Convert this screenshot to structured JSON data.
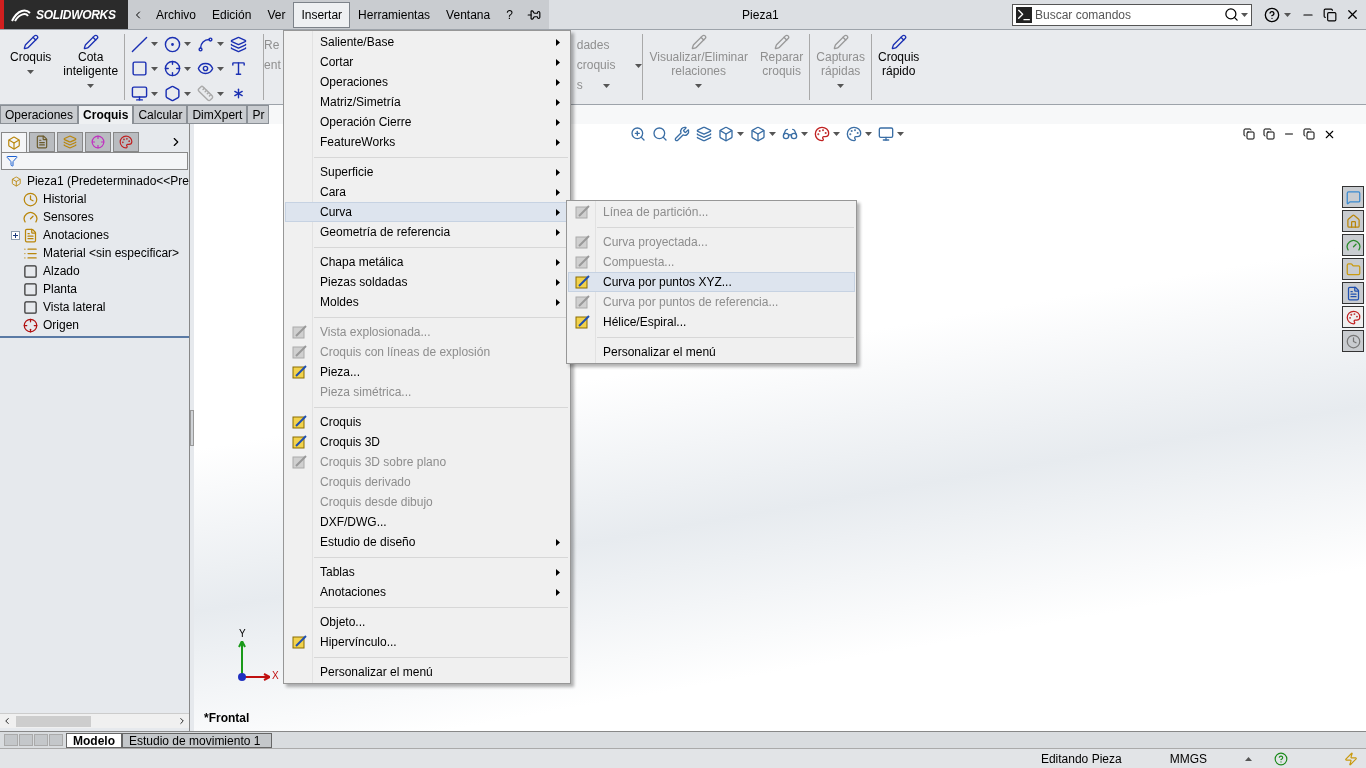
{
  "app": {
    "logo_text": "SOLIDWORKS",
    "title": "Pieza1"
  },
  "menu_bar": [
    {
      "label": "Archivo",
      "selected": false
    },
    {
      "label": "Edición",
      "selected": false
    },
    {
      "label": "Ver",
      "selected": false
    },
    {
      "label": "Insertar",
      "selected": true
    },
    {
      "label": "Herramientas",
      "selected": false
    },
    {
      "label": "Ventana",
      "selected": false
    },
    {
      "label": "?",
      "selected": false
    }
  ],
  "search": {
    "placeholder": "Buscar comandos"
  },
  "ribbon_left": [
    {
      "kind": "big",
      "lines": [
        "Croquis"
      ],
      "disabled": false,
      "dropdown": true
    },
    {
      "kind": "big",
      "lines": [
        "Cota",
        "inteligente"
      ],
      "disabled": false,
      "dropdown": true
    },
    {
      "kind": "separator"
    },
    {
      "kind": "tools"
    },
    {
      "kind": "separator"
    },
    {
      "kind": "cut",
      "lines": [
        "Re",
        "ent"
      ],
      "disabled": true
    }
  ],
  "ribbon_right": [
    {
      "kind": "cut",
      "lines": [
        "dades",
        "croquis",
        "s"
      ],
      "disabled": true,
      "dropdown": true
    },
    {
      "kind": "separator"
    },
    {
      "kind": "big",
      "lines": [
        "Visualizar/Eliminar",
        "relaciones"
      ],
      "disabled": true,
      "dropdown": true
    },
    {
      "kind": "big",
      "lines": [
        "Reparar",
        "croquis"
      ],
      "disabled": true,
      "dropdown": false
    },
    {
      "kind": "separator"
    },
    {
      "kind": "big",
      "lines": [
        "Capturas",
        "rápidas"
      ],
      "disabled": true,
      "dropdown": true
    },
    {
      "kind": "separator"
    },
    {
      "kind": "big",
      "lines": [
        "Croquis",
        "rápido"
      ],
      "disabled": false,
      "dropdown": false
    }
  ],
  "command_tabs": [
    {
      "label": "Operaciones",
      "selected": false
    },
    {
      "label": "Croquis",
      "selected": true
    },
    {
      "label": "Calcular",
      "selected": false
    },
    {
      "label": "DimXpert",
      "selected": false
    },
    {
      "label": "Pr",
      "selected": false
    }
  ],
  "panel_tabs": [
    {
      "selected": true
    },
    {
      "selected": false
    },
    {
      "selected": false
    },
    {
      "selected": false
    },
    {
      "selected": false
    }
  ],
  "tree": [
    {
      "label": "Pieza1  (Predeterminado<<Pre",
      "kind": "part",
      "children": [
        {
          "label": "Historial",
          "kind": "history"
        },
        {
          "label": "Sensores",
          "kind": "sensor"
        },
        {
          "label": "Anotaciones",
          "kind": "annotation",
          "expanded": false
        },
        {
          "label": "Material <sin especificar>",
          "kind": "material"
        },
        {
          "label": "Alzado",
          "kind": "plane"
        },
        {
          "label": "Planta",
          "kind": "plane"
        },
        {
          "label": "Vista lateral",
          "kind": "plane"
        },
        {
          "label": "Origen",
          "kind": "origin"
        }
      ]
    }
  ],
  "insert_menu": [
    {
      "kind": "item",
      "label": "Saliente/Base",
      "submenu": true,
      "disabled": false,
      "icon": false,
      "selected": false
    },
    {
      "kind": "item",
      "label": "Cortar",
      "submenu": true,
      "disabled": false,
      "icon": false,
      "selected": false
    },
    {
      "kind": "item",
      "label": "Operaciones",
      "submenu": true,
      "disabled": false,
      "icon": false,
      "selected": false
    },
    {
      "kind": "item",
      "label": "Matriz/Simetría",
      "submenu": true,
      "disabled": false,
      "icon": false,
      "selected": false
    },
    {
      "kind": "item",
      "label": "Operación Cierre",
      "submenu": true,
      "disabled": false,
      "icon": false,
      "selected": false
    },
    {
      "kind": "item",
      "label": "FeatureWorks",
      "submenu": true,
      "disabled": false,
      "icon": false,
      "selected": false
    },
    {
      "kind": "separator"
    },
    {
      "kind": "item",
      "label": "Superficie",
      "submenu": true,
      "disabled": false,
      "icon": false,
      "selected": false
    },
    {
      "kind": "item",
      "label": "Cara",
      "submenu": true,
      "disabled": false,
      "icon": false,
      "selected": false
    },
    {
      "kind": "item",
      "label": "Curva",
      "submenu": true,
      "disabled": false,
      "icon": false,
      "selected": true
    },
    {
      "kind": "item",
      "label": "Geometría de referencia",
      "submenu": true,
      "disabled": false,
      "icon": false,
      "selected": false
    },
    {
      "kind": "separator"
    },
    {
      "kind": "item",
      "label": "Chapa metálica",
      "submenu": true,
      "disabled": false,
      "icon": false,
      "selected": false
    },
    {
      "kind": "item",
      "label": "Piezas soldadas",
      "submenu": true,
      "disabled": false,
      "icon": false,
      "selected": false
    },
    {
      "kind": "item",
      "label": "Moldes",
      "submenu": true,
      "disabled": false,
      "icon": false,
      "selected": false
    },
    {
      "kind": "separator"
    },
    {
      "kind": "item",
      "label": "Vista explosionada...",
      "submenu": false,
      "disabled": true,
      "icon": true,
      "selected": false
    },
    {
      "kind": "item",
      "label": "Croquis con líneas de explosión",
      "submenu": false,
      "disabled": true,
      "icon": true,
      "selected": false
    },
    {
      "kind": "item",
      "label": "Pieza...",
      "submenu": false,
      "disabled": false,
      "icon": true,
      "selected": false
    },
    {
      "kind": "item",
      "label": "Pieza simétrica...",
      "submenu": false,
      "disabled": true,
      "icon": false,
      "selected": false
    },
    {
      "kind": "separator"
    },
    {
      "kind": "item",
      "label": "Croquis",
      "submenu": false,
      "disabled": false,
      "icon": true,
      "selected": false
    },
    {
      "kind": "item",
      "label": "Croquis 3D",
      "submenu": false,
      "disabled": false,
      "icon": true,
      "selected": false
    },
    {
      "kind": "item",
      "label": "Croquis 3D sobre plano",
      "submenu": false,
      "disabled": true,
      "icon": true,
      "selected": false
    },
    {
      "kind": "item",
      "label": "Croquis derivado",
      "submenu": false,
      "disabled": true,
      "icon": false,
      "selected": false
    },
    {
      "kind": "item",
      "label": "Croquis desde dibujo",
      "submenu": false,
      "disabled": true,
      "icon": false,
      "selected": false
    },
    {
      "kind": "item",
      "label": "DXF/DWG...",
      "submenu": false,
      "disabled": false,
      "icon": false,
      "selected": false
    },
    {
      "kind": "item",
      "label": "Estudio de diseño",
      "submenu": true,
      "disabled": false,
      "icon": false,
      "selected": false
    },
    {
      "kind": "separator"
    },
    {
      "kind": "item",
      "label": "Tablas",
      "submenu": true,
      "disabled": false,
      "icon": false,
      "selected": false
    },
    {
      "kind": "item",
      "label": "Anotaciones",
      "submenu": true,
      "disabled": false,
      "icon": false,
      "selected": false
    },
    {
      "kind": "separator"
    },
    {
      "kind": "item",
      "label": "Objeto...",
      "submenu": false,
      "disabled": false,
      "icon": false,
      "selected": false
    },
    {
      "kind": "item",
      "label": "Hipervínculo...",
      "submenu": false,
      "disabled": false,
      "icon": true,
      "selected": false
    },
    {
      "kind": "separator"
    },
    {
      "kind": "item",
      "label": "Personalizar el menú",
      "submenu": false,
      "disabled": false,
      "icon": false,
      "selected": false
    }
  ],
  "curve_submenu": [
    {
      "kind": "item",
      "label": "Línea de partición...",
      "submenu": false,
      "disabled": true,
      "icon": true,
      "selected": false
    },
    {
      "kind": "separator"
    },
    {
      "kind": "item",
      "label": "Curva proyectada...",
      "submenu": false,
      "disabled": true,
      "icon": true,
      "selected": false
    },
    {
      "kind": "item",
      "label": "Compuesta...",
      "submenu": false,
      "disabled": true,
      "icon": true,
      "selected": false
    },
    {
      "kind": "item",
      "label": "Curva por puntos XYZ...",
      "submenu": false,
      "disabled": false,
      "icon": true,
      "selected": true
    },
    {
      "kind": "item",
      "label": "Curva por puntos de referencia...",
      "submenu": false,
      "disabled": true,
      "icon": true,
      "selected": false
    },
    {
      "kind": "item",
      "label": "Hélice/Espiral...",
      "submenu": false,
      "disabled": false,
      "icon": true,
      "selected": false
    },
    {
      "kind": "separator"
    },
    {
      "kind": "item",
      "label": "Personalizar el menú",
      "submenu": false,
      "disabled": false,
      "icon": false,
      "selected": false
    }
  ],
  "viewport": {
    "view_name": "*Frontal",
    "triad": {
      "x_label": "X",
      "y_label": "Y"
    }
  },
  "bottom_tabs": [
    {
      "label": "Modelo",
      "selected": true
    },
    {
      "label": "Estudio de movimiento 1",
      "selected": false
    }
  ],
  "status_bar": {
    "mode": "Editando Pieza",
    "units": "MMGS"
  }
}
